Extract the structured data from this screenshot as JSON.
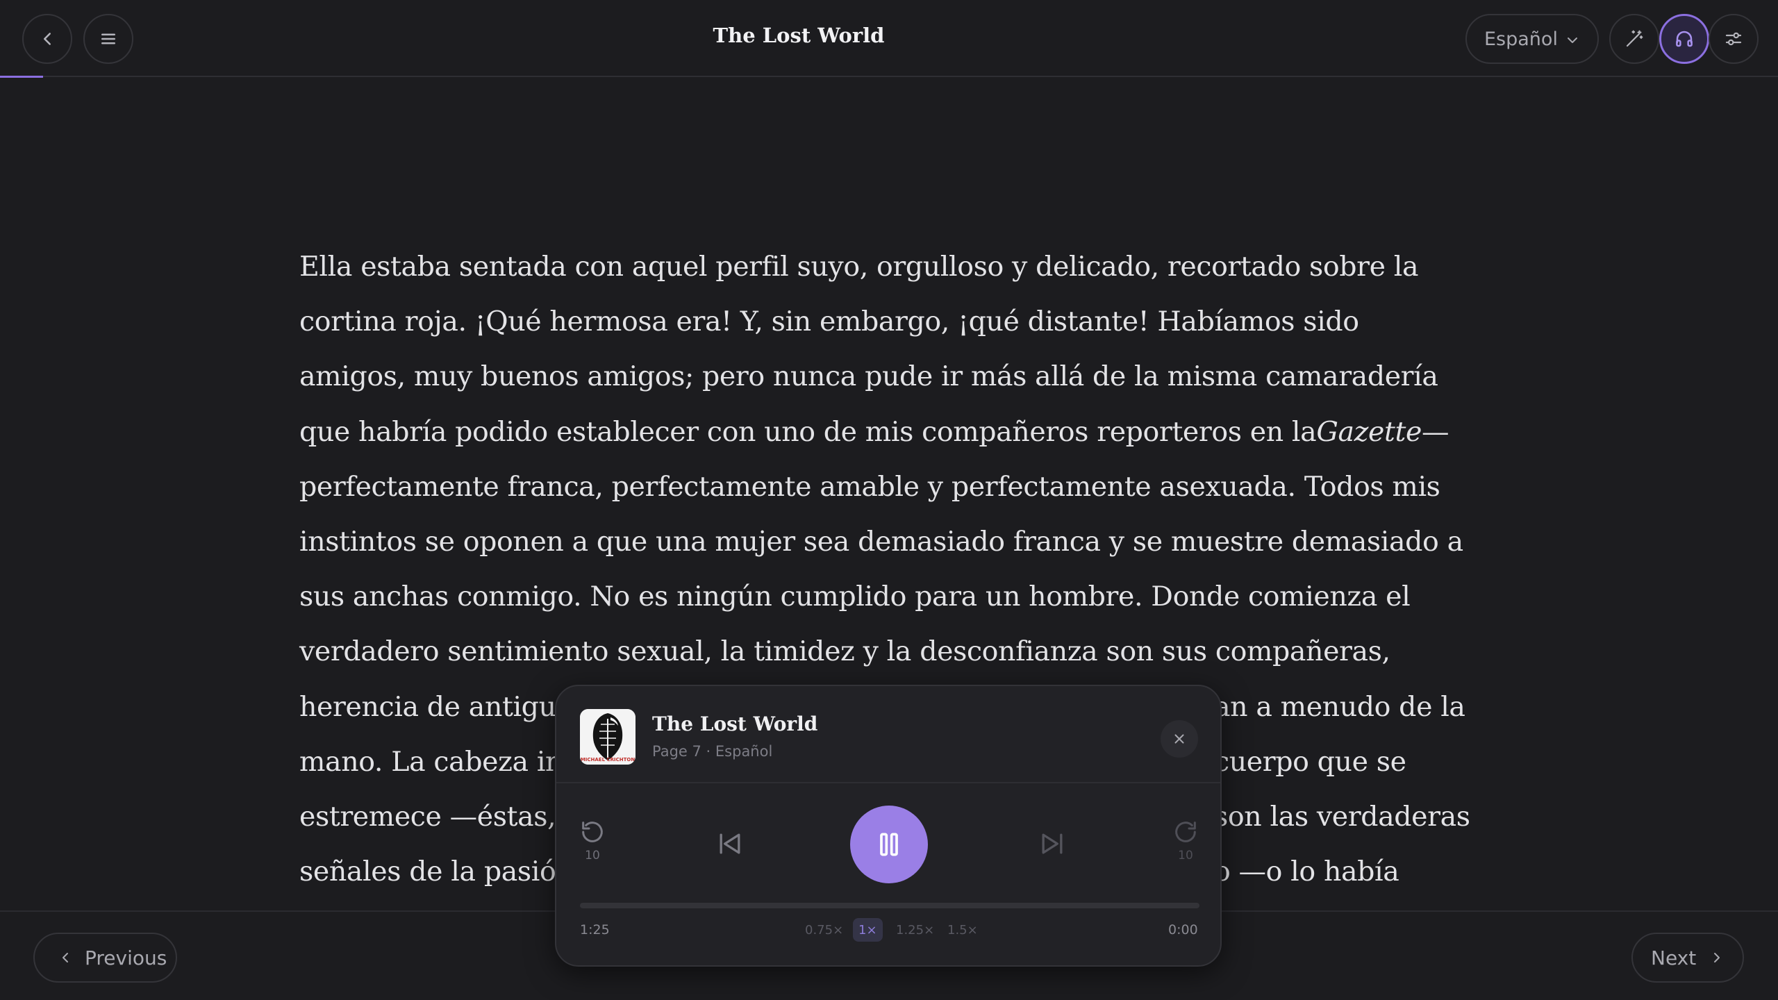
{
  "header": {
    "title": "The Lost World",
    "language": "Español"
  },
  "content": {
    "lines": [
      "Ella estaba sentada con aquel perfil suyo, orgulloso y delicado, recortado sobre la",
      "cortina roja. ¡Qué hermosa era! Y, sin embargo, ¡qué distante! Habíamos sido",
      "amigos, muy buenos amigos; pero nunca pude ir más allá de la misma camaradería",
      "perfectamente franca, perfectamente amable y perfectamente asexuada. Todos mis",
      "instintos se oponen a que una mujer sea demasiado franca y se muestre demasiado a",
      "sus anchas conmigo. No es ningún cumplido para un hombre. Donde comienza el",
      "verdadero sentimiento sexual, la timidez y la desconfianza son sus compañeras,",
      "herencia de antigu",
      "an a menudo de la",
      "mano. La cabeza in",
      "cuerpo que se",
      "estremece —éstas,",
      "son las verdaderas",
      "señales de la pasió",
      "o —o lo había"
    ],
    "line4_prefix": "que habría podido establecer con uno de mis compañeros reporteros en la",
    "line4_italic": "Gazette",
    "line4_suffix": "—"
  },
  "footer": {
    "previous_label": "Previous",
    "next_label": "Next"
  },
  "player": {
    "title": "The Lost World",
    "subtitle": "Page 7 · Español",
    "cover_text": "MICHAEL CRICHTON",
    "rewind_seconds": "10",
    "forward_seconds": "10",
    "current_time": "1:25",
    "total_time": "0:00",
    "speeds": [
      "0.75×",
      "1×",
      "1.25×",
      "1.5×"
    ],
    "selected_speed": "1×",
    "progress": 0
  },
  "colors": {
    "accent": "#9a7fe6",
    "background": "#1c1c1f",
    "panel": "#222226"
  }
}
